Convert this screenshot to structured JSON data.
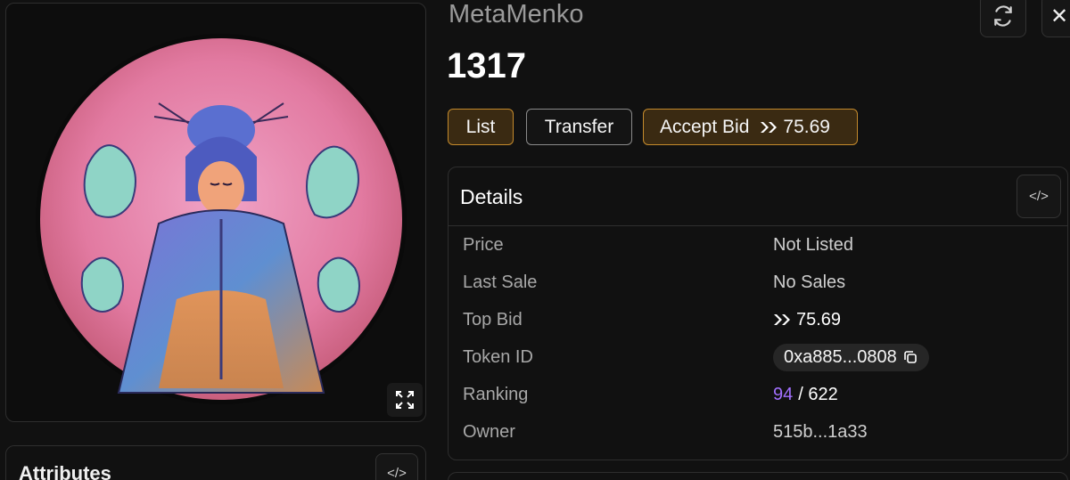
{
  "header": {
    "collection_name": "MetaMenko",
    "token_title": "1317"
  },
  "actions": {
    "list_label": "List",
    "transfer_label": "Transfer",
    "accept_bid_label": "Accept Bid",
    "accept_bid_amount": "75.69"
  },
  "details": {
    "title": "Details",
    "rows": {
      "price": {
        "label": "Price",
        "value": "Not Listed"
      },
      "last_sale": {
        "label": "Last Sale",
        "value": "No Sales"
      },
      "top_bid": {
        "label": "Top Bid",
        "value": "75.69"
      },
      "token_id": {
        "label": "Token ID",
        "value": "0xa885...0808"
      },
      "ranking": {
        "label": "Ranking",
        "rank": "94",
        "total": "/ 622"
      },
      "owner": {
        "label": "Owner",
        "value": "515b...1a33"
      }
    }
  },
  "attributes": {
    "title": "Attributes"
  },
  "icons": {
    "refresh": "refresh-icon",
    "close": "close-icon",
    "expand": "expand-icon",
    "code": "code-icon",
    "copy": "copy-icon",
    "currency": "currency-icon"
  },
  "colors": {
    "accent_border": "#c48a2c",
    "accent_bg": "#3a2a12",
    "rank_purple": "#a270ff",
    "image_background": "#d9748d"
  }
}
